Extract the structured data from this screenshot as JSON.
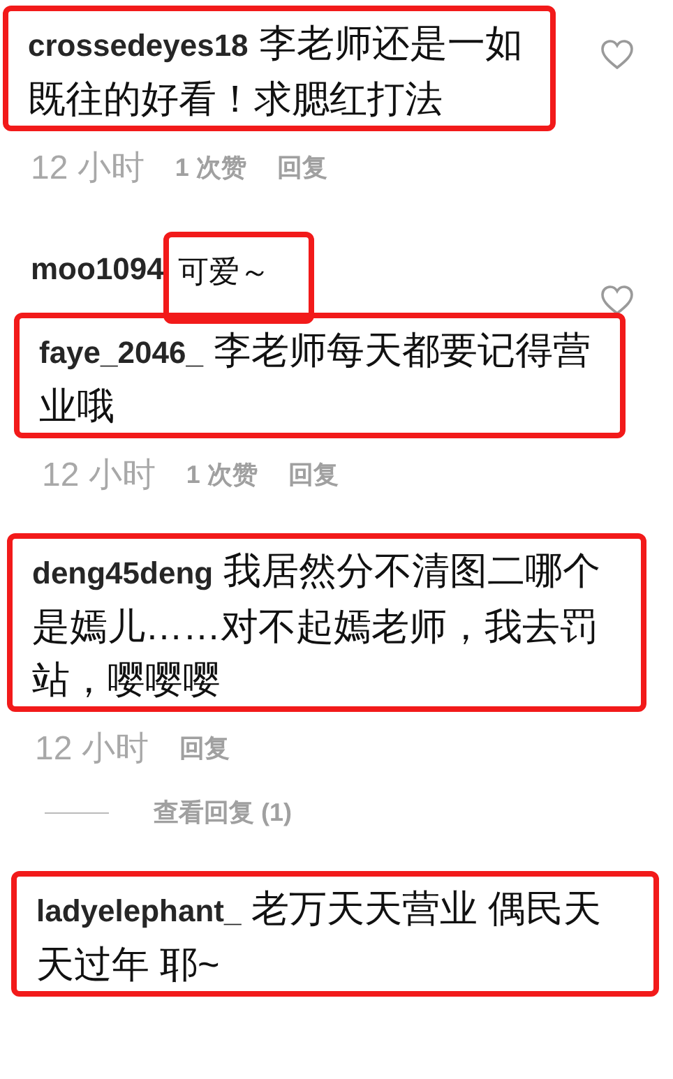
{
  "comments": [
    {
      "kind": "boxed",
      "username": "crossedeyes18",
      "text": "李老师还是一如既往的好看！求腮红打法",
      "like_icon": true,
      "meta": {
        "time": "12 小时",
        "likes": "1 次赞",
        "reply": "回复"
      }
    },
    {
      "kind": "marked",
      "username": "moo1094",
      "text": "可爱～",
      "like_icon": true
    },
    {
      "kind": "boxed",
      "username": "faye_2046_",
      "text": "李老师每天都要记得营业哦",
      "like_icon": false,
      "meta": {
        "time": "12 小时",
        "likes": "1 次赞",
        "reply": "回复"
      }
    },
    {
      "kind": "boxed",
      "username": "deng45deng",
      "text": "我居然分不清图二哪个是嫣儿……对不起嫣老师，我去罚站，嘤嘤嘤",
      "like_icon": false,
      "meta": {
        "time": "12 小时",
        "reply": "回复"
      },
      "view_replies": "查看回复 (1)"
    },
    {
      "kind": "boxed",
      "username": "ladyelephant_",
      "text": "老万天天营业 偶民天天过年 耶~",
      "like_icon": false
    }
  ]
}
